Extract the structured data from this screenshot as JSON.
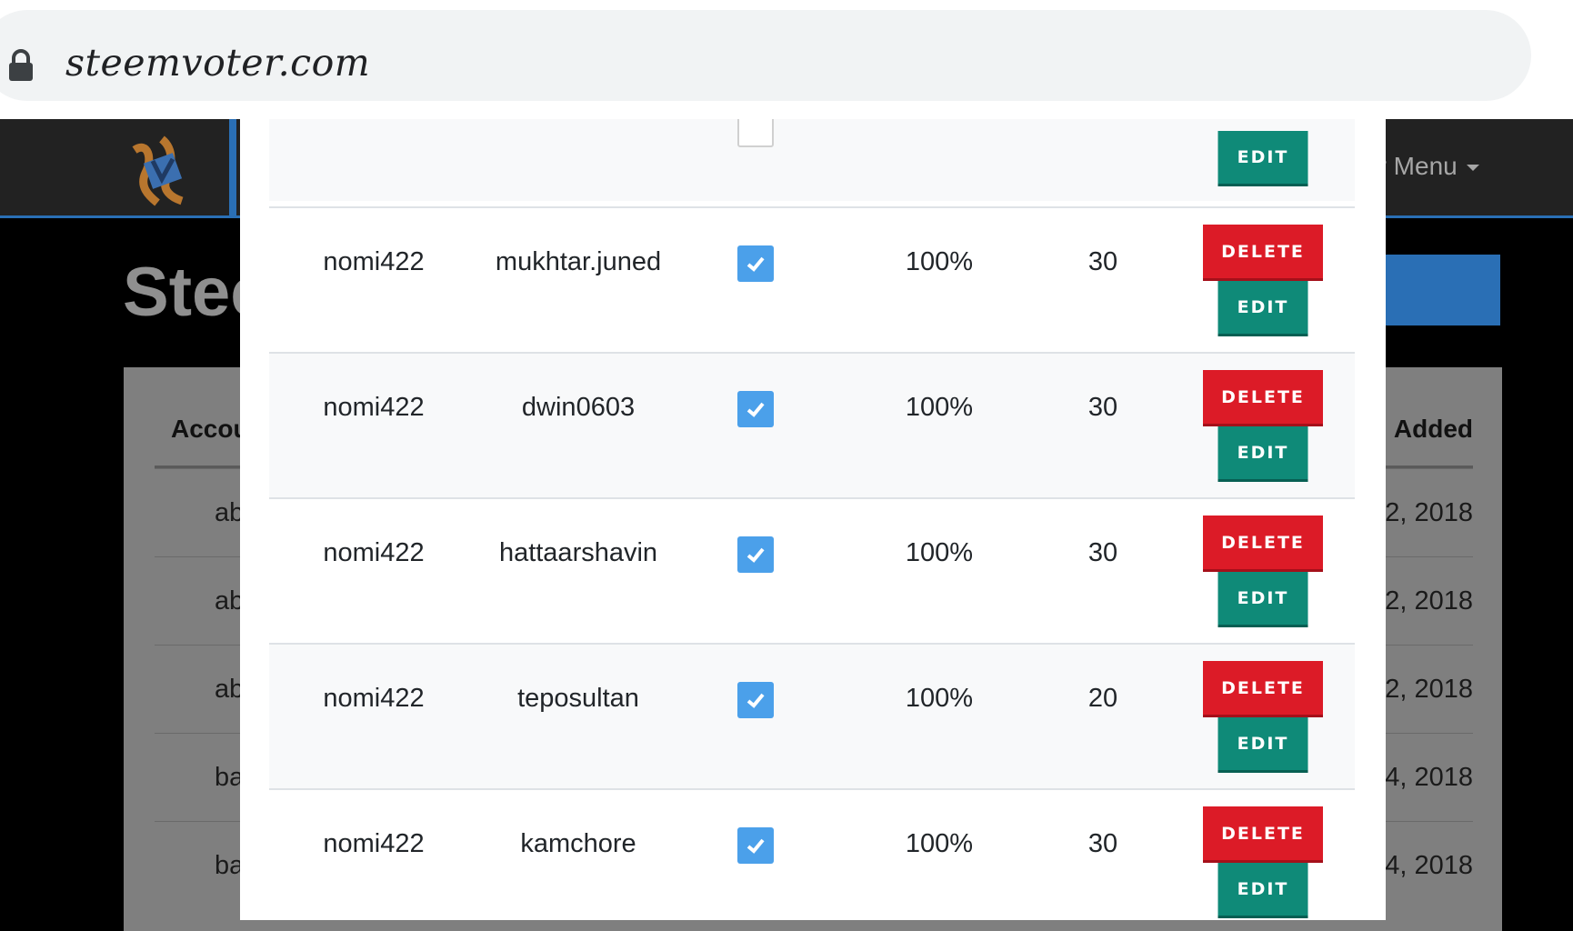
{
  "browser": {
    "url": "steemvoter.com"
  },
  "site": {
    "heading": "Stee",
    "user_menu": "er Menu",
    "bg_table": {
      "header_left": "Accou",
      "header_right": "Added",
      "rows": [
        {
          "left": "ab",
          "right": "2, 2018"
        },
        {
          "left": "ab",
          "right": "2, 2018"
        },
        {
          "left": "ab",
          "right": "2, 2018"
        },
        {
          "left": "ba",
          "right": "4, 2018"
        },
        {
          "left": "ba",
          "right": "4, 2018"
        }
      ]
    }
  },
  "modal": {
    "delete_label": "DELETE",
    "edit_label": "EDIT",
    "rows": [
      {
        "account": "nomi422",
        "target": "mukhtar.juned",
        "enabled": true,
        "weight": "100%",
        "delay": "30"
      },
      {
        "account": "nomi422",
        "target": "dwin0603",
        "enabled": true,
        "weight": "100%",
        "delay": "30"
      },
      {
        "account": "nomi422",
        "target": "hattaarshavin",
        "enabled": true,
        "weight": "100%",
        "delay": "30"
      },
      {
        "account": "nomi422",
        "target": "teposultan",
        "enabled": true,
        "weight": "100%",
        "delay": "20"
      },
      {
        "account": "nomi422",
        "target": "kamchore",
        "enabled": true,
        "weight": "100%",
        "delay": "30"
      }
    ]
  },
  "colors": {
    "delete": "#dc1b27",
    "edit": "#0f8a78",
    "checkbox": "#4ba0ea",
    "nav_accent": "#2a6fb5"
  }
}
